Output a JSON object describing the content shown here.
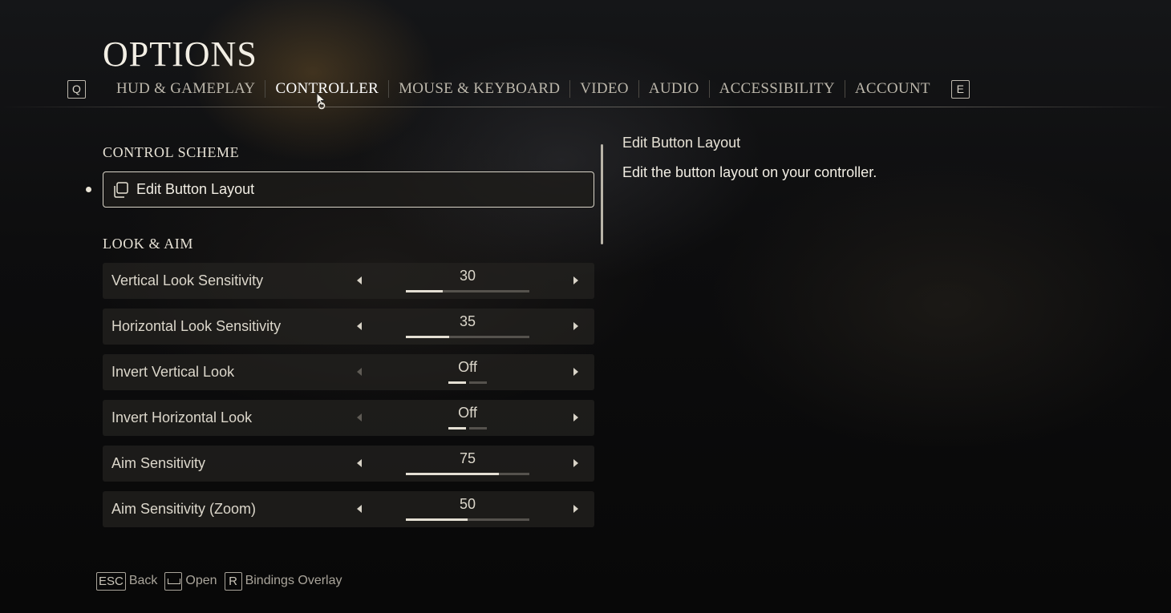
{
  "page": {
    "title": "OPTIONS"
  },
  "tabs": {
    "prev_key": "Q",
    "next_key": "E",
    "items": [
      {
        "label": "HUD & GAMEPLAY",
        "active": false
      },
      {
        "label": "CONTROLLER",
        "active": true
      },
      {
        "label": "MOUSE & KEYBOARD",
        "active": false
      },
      {
        "label": "VIDEO",
        "active": false
      },
      {
        "label": "AUDIO",
        "active": false
      },
      {
        "label": "ACCESSIBILITY",
        "active": false
      },
      {
        "label": "ACCOUNT",
        "active": false
      }
    ]
  },
  "sections": {
    "control_scheme": {
      "title": "CONTROL SCHEME",
      "edit_button": {
        "label": "Edit Button Layout",
        "icon": "copy-layout-icon",
        "selected": true
      }
    },
    "look_aim": {
      "title": "LOOK & AIM",
      "rows": [
        {
          "label": "Vertical Look Sensitivity",
          "value": "30",
          "type": "slider",
          "level": 0.3
        },
        {
          "label": "Horizontal Look Sensitivity",
          "value": "35",
          "type": "slider",
          "level": 0.35
        },
        {
          "label": "Invert Vertical Look",
          "value": "Off",
          "type": "toggle",
          "level": 0.0
        },
        {
          "label": "Invert Horizontal Look",
          "value": "Off",
          "type": "toggle",
          "level": 0.0
        },
        {
          "label": "Aim Sensitivity",
          "value": "75",
          "type": "slider",
          "level": 0.75
        },
        {
          "label": "Aim Sensitivity (Zoom)",
          "value": "50",
          "type": "slider",
          "level": 0.5
        }
      ]
    }
  },
  "description": {
    "title": "Edit Button Layout",
    "text": "Edit the button layout on your controller."
  },
  "footer": {
    "back_key": "ESC",
    "back_label": "Back",
    "open_label": "Open",
    "overlay_key": "R",
    "overlay_label": "Bindings Overlay"
  },
  "colors": {
    "text": "#e9e4d6",
    "accent_fill": "#e4dfd3",
    "track": "#55524d",
    "row_bg": "#242220"
  }
}
